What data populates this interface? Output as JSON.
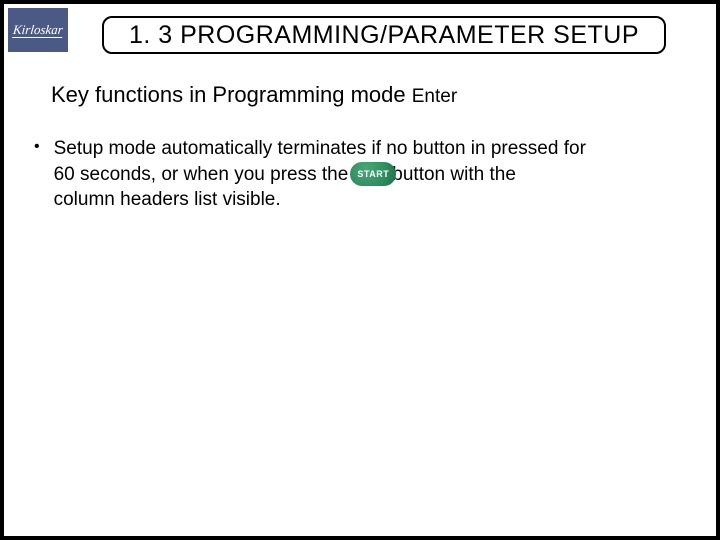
{
  "logo": {
    "brand": "Kirloskar"
  },
  "title": "1. 3 PROGRAMMING/PARAMETER SETUP",
  "subtitle": {
    "main": "Key functions in Programming mode ",
    "suffix": "Enter"
  },
  "bullet": {
    "marker": "•",
    "line1": "Setup mode automatically terminates if no button in pressed for",
    "line2_pre": " 60 seconds, or when you press the ",
    "start_label": "START",
    "line2_post": "button with the",
    "line3": " column headers list visible."
  }
}
